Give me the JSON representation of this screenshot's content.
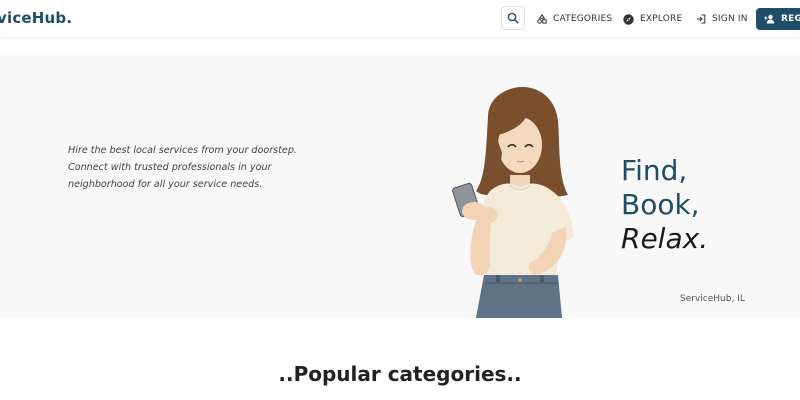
{
  "navbar": {
    "brand": "viceHub.",
    "search_icon": "search-icon",
    "links": [
      {
        "label": "CATEGORIES",
        "icon": "shapes-icon"
      },
      {
        "label": "EXPLORE",
        "icon": "compass-icon"
      },
      {
        "label": "SIGN IN",
        "icon": "sign-in-icon"
      }
    ],
    "register": {
      "label": "REGI",
      "icon": "person-add-icon"
    }
  },
  "hero": {
    "description_lines": [
      "Hire the best local services from your doorstep.",
      "Connect with trusted professionals in your",
      "neighborhood for all your service needs."
    ],
    "headline": [
      "Find,",
      "Book,",
      "Relax."
    ],
    "location": "ServiceHub, IL",
    "illustration": "woman-using-phone-illustration"
  },
  "popular": {
    "title": "..Popular categories.."
  },
  "colors": {
    "primary": "#1f4e6b",
    "hero_bg": "#f8f8f8",
    "text": "#333333"
  }
}
